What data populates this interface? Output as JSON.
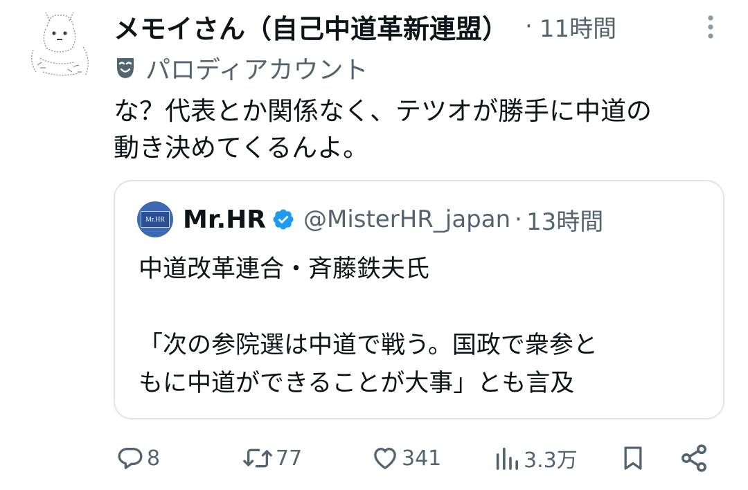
{
  "tweet": {
    "display_name": "メモイさん（自己中道革新連盟）",
    "meta_separator": "·",
    "timestamp": "11時間",
    "parody_label": "パロディアカウント",
    "text_lines": [
      "な？代表とか関係なく、テツオが勝手に中道の",
      "動き決めてくるんよ。"
    ],
    "avatar_icon": "ascii-art-cat-avatar"
  },
  "quote": {
    "avatar_text": "Mr.HR",
    "name": "Mr.HR",
    "handle": "@MisterHR_japan",
    "separator": "·",
    "timestamp": "13時間",
    "text_lines": [
      "中道改革連合・斉藤鉄夫氏",
      "",
      "「次の参院選は中道で戦う。国政で衆参と",
      "もに中道ができることが大事」とも言及"
    ],
    "verified_color": "#1d9bf0",
    "avatar_color": "#3c68b4"
  },
  "actions": {
    "reply_count": "8",
    "retweet_count": "77",
    "like_count": "341",
    "views_count": "3.3万"
  },
  "colors": {
    "text_primary": "#0f1419",
    "text_secondary": "#536471",
    "border": "#dfe4e8",
    "verified": "#1d9bf0"
  }
}
